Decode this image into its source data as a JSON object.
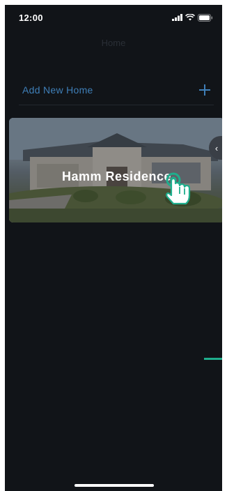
{
  "status_bar": {
    "time": "12:00"
  },
  "header": {
    "title": "Home"
  },
  "add_home": {
    "label": "Add New Home",
    "icon": "plus-icon"
  },
  "homes": [
    {
      "name": "Hamm Residence"
    }
  ],
  "colors": {
    "background": "#111418",
    "accent_blue": "#3f7fb8",
    "accent_green": "#1fae8d"
  }
}
